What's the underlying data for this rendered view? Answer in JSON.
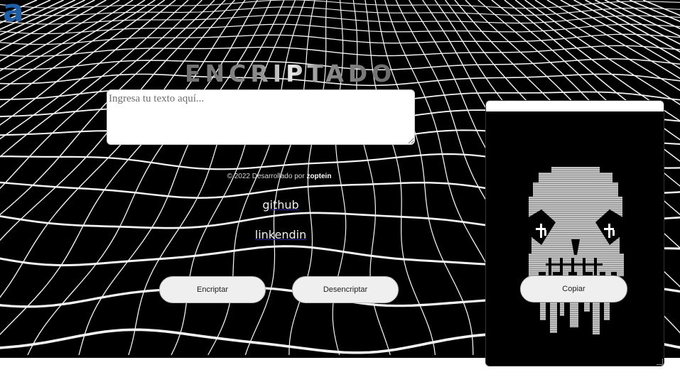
{
  "header": {
    "logo": "a",
    "title": "ENCRIPTADOR"
  },
  "input": {
    "placeholder": "Ingresa tu texto aquí..."
  },
  "footer": {
    "copyright_prefix": "© 2022 Desarrollado por ",
    "author": "zoptein",
    "links": {
      "github": "github",
      "linkedin": "linkendin"
    }
  },
  "buttons": {
    "encrypt": "Encriptar",
    "decrypt": "Desencriptar",
    "copy": "Copiar"
  },
  "output": {
    "image": "pixel-skull-icon"
  },
  "colors": {
    "background": "#000000",
    "grid": "#ffffff",
    "logo": "#1f5fa8",
    "button": "#efefef"
  }
}
